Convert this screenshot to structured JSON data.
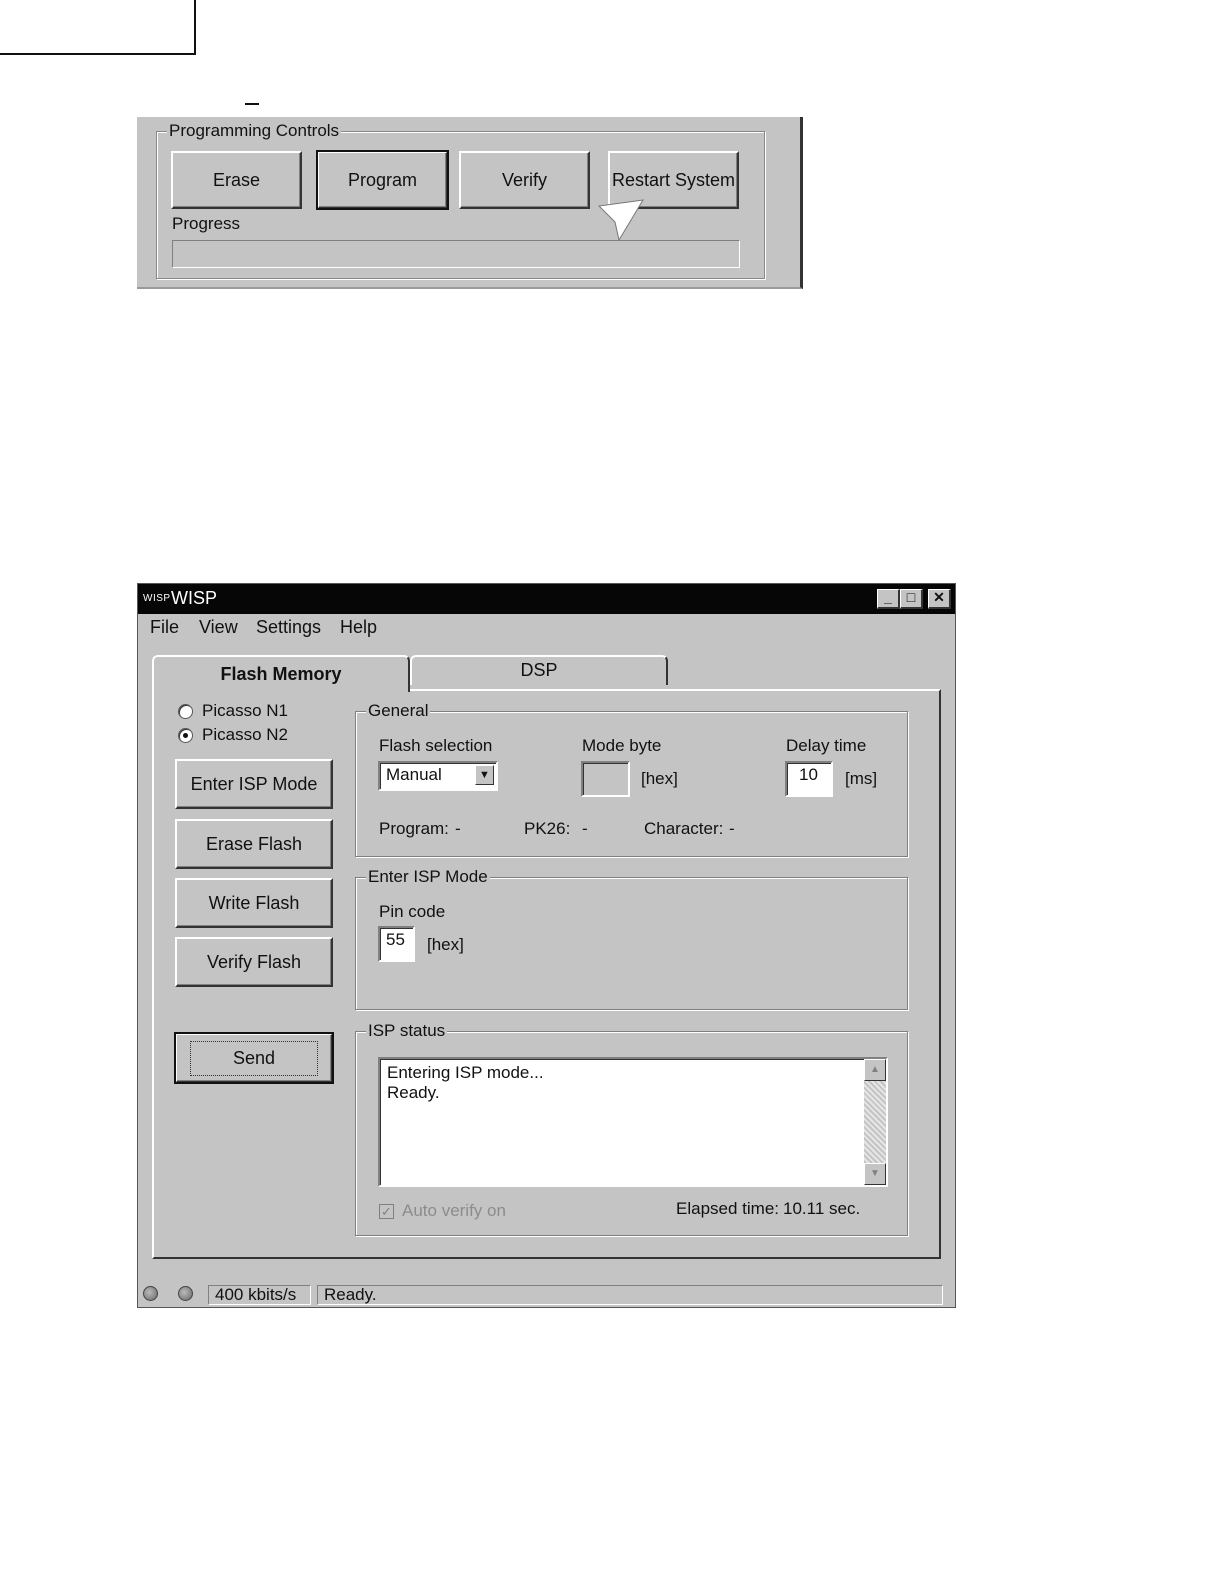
{
  "programming_controls": {
    "group_label": "Programming Controls",
    "buttons": {
      "erase": "Erase",
      "program": "Program",
      "verify": "Verify",
      "restart": "Restart System"
    },
    "progress_label": "Progress",
    "progress": 0
  },
  "wisp": {
    "logo_text": "WISP",
    "title": "WISP",
    "window_buttons": {
      "minimize": "_",
      "maximize": "□",
      "close": "✕"
    },
    "menu": [
      "File",
      "View",
      "Settings",
      "Help"
    ],
    "tabs": {
      "flash": "Flash Memory",
      "dsp": "DSP"
    },
    "radios": [
      {
        "label": "Picasso N1",
        "checked": false
      },
      {
        "label": "Picasso N2",
        "checked": true
      }
    ],
    "left_buttons": {
      "enter_isp": "Enter ISP Mode",
      "erase_flash": "Erase Flash",
      "write_flash": "Write Flash",
      "verify_flash": "Verify Flash",
      "send": "Send"
    },
    "general": {
      "label": "General",
      "flash_selection_label": "Flash selection",
      "flash_selection_value": "Manual",
      "mode_byte_label": "Mode byte",
      "mode_byte_value": "",
      "mode_byte_unit": "[hex]",
      "delay_label": "Delay time",
      "delay_value": "10",
      "delay_unit": "[ms]",
      "program_label": "Program:",
      "program_value": "-",
      "pk26_label": "PK26:",
      "pk26_value": "-",
      "character_label": "Character:",
      "character_value": "-"
    },
    "enter_isp": {
      "label": "Enter ISP Mode",
      "pin_label": "Pin code",
      "pin_value": "55",
      "pin_unit": "[hex]"
    },
    "isp_status": {
      "label": "ISP status",
      "lines": [
        "Entering ISP mode...",
        "Ready."
      ],
      "auto_verify_label": "Auto verify on",
      "auto_verify_checked": true,
      "elapsed_label": "Elapsed time:",
      "elapsed_value": "10.11 sec."
    },
    "status_bar": {
      "speed": "400 kbits/s",
      "status": "Ready."
    }
  }
}
